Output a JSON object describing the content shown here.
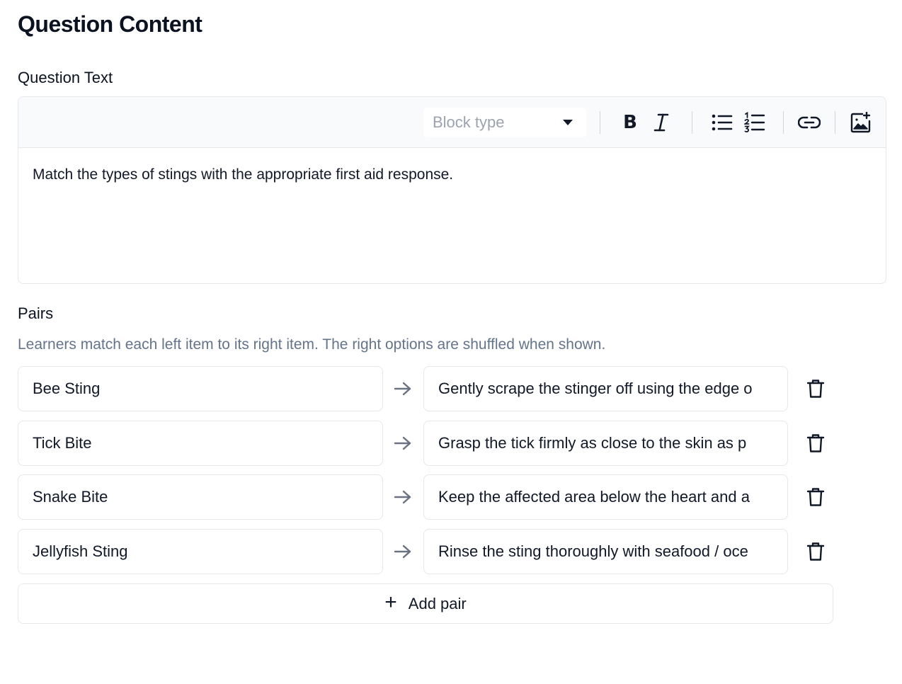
{
  "page": {
    "title": "Question Content"
  },
  "question_text": {
    "label": "Question Text",
    "block_type_placeholder": "Block type",
    "bold_label": "B",
    "content": "Match the types of stings with the appropriate first aid response."
  },
  "toolbar_icons": [
    "chevron-down-icon",
    "bold-icon",
    "italic-icon",
    "bullet-list-icon",
    "numbered-list-icon",
    "link-icon",
    "add-image-icon"
  ],
  "pairs": {
    "label": "Pairs",
    "help": "Learners match each left item to its right item. The right options are shuffled when shown.",
    "items": [
      {
        "left": "Bee Sting",
        "right": "Gently scrape the stinger off using the edge o"
      },
      {
        "left": "Tick Bite",
        "right": "Grasp the tick firmly as close to the skin as p"
      },
      {
        "left": "Snake Bite",
        "right": "Keep the affected area below the heart and a"
      },
      {
        "left": "Jellyfish Sting",
        "right": "Rinse the sting thoroughly with seafood / oce"
      }
    ],
    "add_label": "Add pair",
    "add_icon": "+"
  },
  "colors": {
    "border": "#e5e7eb",
    "toolbar_bg": "#f8fafc",
    "muted_text": "#64748b",
    "text": "#111827"
  }
}
